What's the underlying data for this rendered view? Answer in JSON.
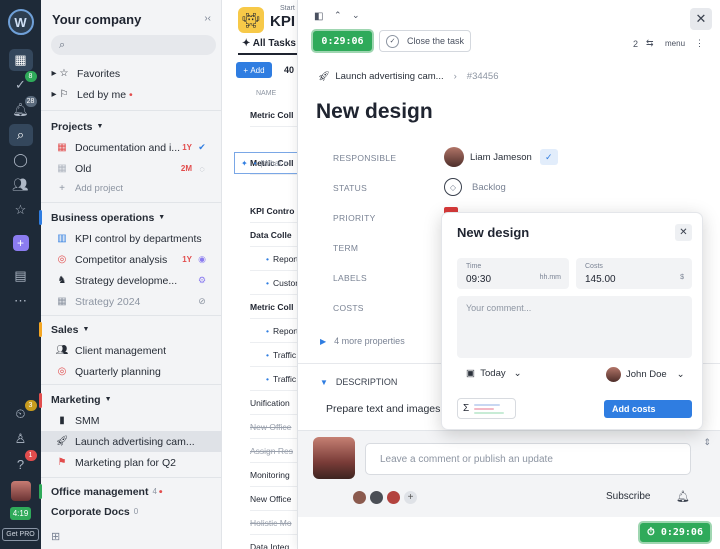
{
  "rail": {
    "logo": "W",
    "badges": {
      "tasks": "8",
      "notifications": "28",
      "timer_alerts": "3",
      "help": "1"
    },
    "time_chip": "4:19",
    "get_pro": "Get PRO"
  },
  "sidebar": {
    "company": "Your company",
    "favorites": "Favorites",
    "led_by_me": "Led by me",
    "projects_header": "Projects",
    "projects": [
      {
        "label": "Documentation and i...",
        "tag": "1Y"
      },
      {
        "label": "Old",
        "tag": "2M"
      },
      {
        "label": "Add project"
      }
    ],
    "business_ops_header": "Business operations",
    "business_ops": [
      {
        "label": "KPI control by departments"
      },
      {
        "label": "Competitor analysis",
        "tag": "1Y"
      },
      {
        "label": "Strategy developme..."
      },
      {
        "label": "Strategy 2024"
      }
    ],
    "sales_header": "Sales",
    "sales": [
      {
        "label": "Client management"
      },
      {
        "label": "Quarterly planning"
      }
    ],
    "marketing_header": "Marketing",
    "marketing": [
      {
        "label": "SMM"
      },
      {
        "label": "Launch advertising cam..."
      },
      {
        "label": "Marketing plan for Q2"
      }
    ],
    "office_header": "Office management",
    "office_count": "4",
    "corp_header": "Corporate Docs",
    "corp_count": "0"
  },
  "tasklist": {
    "start_label": "Start",
    "title": "KPI C",
    "tab": "All Tasks",
    "add_button": "Add",
    "count": "40",
    "column_name": "NAME",
    "new_placeholder": "|What n",
    "rows": [
      {
        "label": "Metric Coll",
        "style": "b"
      },
      {
        "label": "Metric Coll",
        "style": "b"
      },
      {
        "label": "KPI Contro",
        "style": "b"
      },
      {
        "label": "Data Colle",
        "style": "b"
      },
      {
        "label": "Report C",
        "style": "sub"
      },
      {
        "label": "Custome",
        "style": "sub"
      },
      {
        "label": "Metric Coll",
        "style": "b"
      },
      {
        "label": "Report C",
        "style": "sub"
      },
      {
        "label": "Traffic a",
        "style": "sub"
      },
      {
        "label": "Traffic a",
        "style": "sub"
      },
      {
        "label": "Unification",
        "style": ""
      },
      {
        "label": "New Office",
        "style": "strike"
      },
      {
        "label": "Assign Res",
        "style": "strike"
      },
      {
        "label": "Monitoring",
        "style": ""
      },
      {
        "label": "New Office",
        "style": ""
      },
      {
        "label": "Holistic Mo",
        "style": "strike"
      },
      {
        "label": "Data Integ",
        "style": ""
      }
    ]
  },
  "panel": {
    "timer": "0:29:06",
    "close_task": "Close the task",
    "subtask_count": "2",
    "menu": "menu",
    "breadcrumb": "Launch advertising cam...",
    "task_id": "#34456",
    "title": "New design",
    "props": {
      "responsible_label": "RESPONSIBLE",
      "responsible_value": "Liam Jameson",
      "status_label": "STATUS",
      "status_value": "Backlog",
      "priority_label": "PRIORITY",
      "term_label": "TERM",
      "labels_label": "LABELS",
      "costs_label": "COSTS"
    },
    "more_properties": "4 more properties",
    "description_label": "DESCRIPTION",
    "description_text": "Prepare text and images",
    "comment_placeholder": "Leave a comment or publish an update",
    "subscribe": "Subscribe",
    "bottom_timer": "0:29:06"
  },
  "popup": {
    "title": "New design",
    "time_label": "Time",
    "time_value": "09:30",
    "time_unit": "hh.mm",
    "costs_label": "Costs",
    "costs_value": "145.00",
    "costs_unit": "$",
    "comment_placeholder": "Your comment...",
    "date": "Today",
    "user": "John Doe",
    "sigma": "Σ",
    "add_costs": "Add costs"
  }
}
